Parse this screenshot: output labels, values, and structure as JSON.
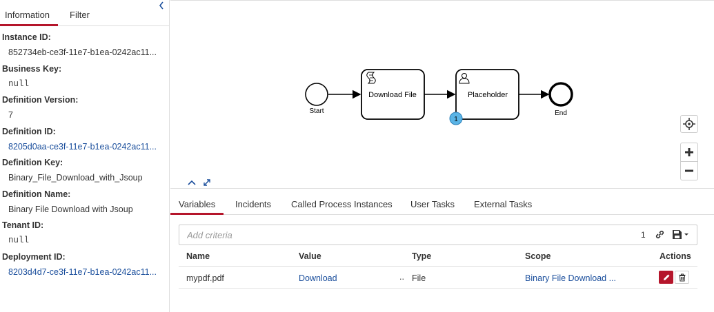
{
  "sidebar": {
    "tabs": [
      {
        "label": "Information",
        "active": true
      },
      {
        "label": "Filter",
        "active": false
      }
    ],
    "items": [
      {
        "label": "Instance ID:",
        "value": "852734eb-ce3f-11e7-b1ea-0242ac11..."
      },
      {
        "label": "Business Key:",
        "value": "null"
      },
      {
        "label": "Definition Version:",
        "value": "7"
      },
      {
        "label": "Definition ID:",
        "value": "8205d0aa-ce3f-11e7-b1ea-0242ac11..."
      },
      {
        "label": "Definition Key:",
        "value": "Binary_File_Download_with_Jsoup"
      },
      {
        "label": "Definition Name:",
        "value": "Binary File Download with Jsoup"
      },
      {
        "label": "Tenant ID:",
        "value": "null"
      },
      {
        "label": "Deployment ID:",
        "value": "8203d4d7-ce3f-11e7-b1ea-0242ac11..."
      }
    ]
  },
  "diagram": {
    "start_label": "Start",
    "task1_label": "Download File",
    "task2_label": "Placeholder",
    "end_label": "End",
    "badge_count": "1"
  },
  "tabs": [
    {
      "label": "Variables",
      "active": true
    },
    {
      "label": "Incidents",
      "active": false
    },
    {
      "label": "Called Process Instances",
      "active": false
    },
    {
      "label": "User Tasks",
      "active": false
    },
    {
      "label": "External Tasks",
      "active": false
    }
  ],
  "search": {
    "placeholder": "Add criteria",
    "count": "1"
  },
  "table": {
    "headers": {
      "name": "Name",
      "value": "Value",
      "type": "Type",
      "scope": "Scope",
      "actions": "Actions"
    },
    "rows": [
      {
        "name": "mypdf.pdf",
        "value": "Download",
        "dots": "..",
        "type": "File",
        "scope": "Binary File Download ..."
      }
    ]
  },
  "colors": {
    "accent": "#b5152b",
    "link": "#1a4e9c",
    "badge": "#5ab4e6"
  }
}
